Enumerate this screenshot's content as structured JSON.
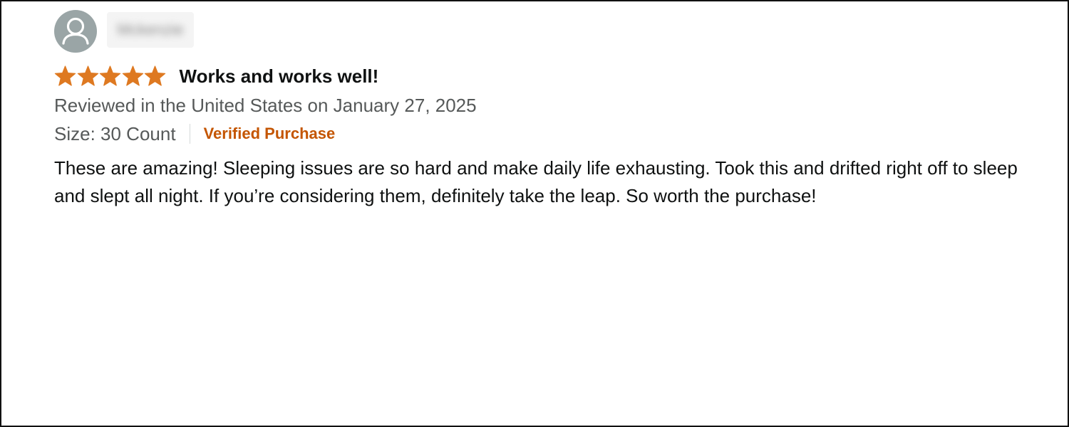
{
  "reviewer": {
    "name": "Mckenzie",
    "avatar_icon": "user-silhouette-icon"
  },
  "rating": {
    "stars": 5,
    "max_stars": 5,
    "star_color": "#de7921",
    "star_icon": "star-icon"
  },
  "review": {
    "title": "Works and works well!",
    "date_line": "Reviewed in the United States on January 27, 2025",
    "variant": "Size: 30 Count",
    "verified_label": "Verified Purchase",
    "body": "These are amazing! Sleeping issues are so hard and make daily life exhausting. Took this and drifted right off to sleep and slept all night. If you’re considering them, definitely take the leap. So worth the purchase!"
  },
  "colors": {
    "title_text": "#0f1111",
    "secondary_text": "#565959",
    "verified": "#c45500",
    "avatar_bg": "#9aa5a6"
  }
}
